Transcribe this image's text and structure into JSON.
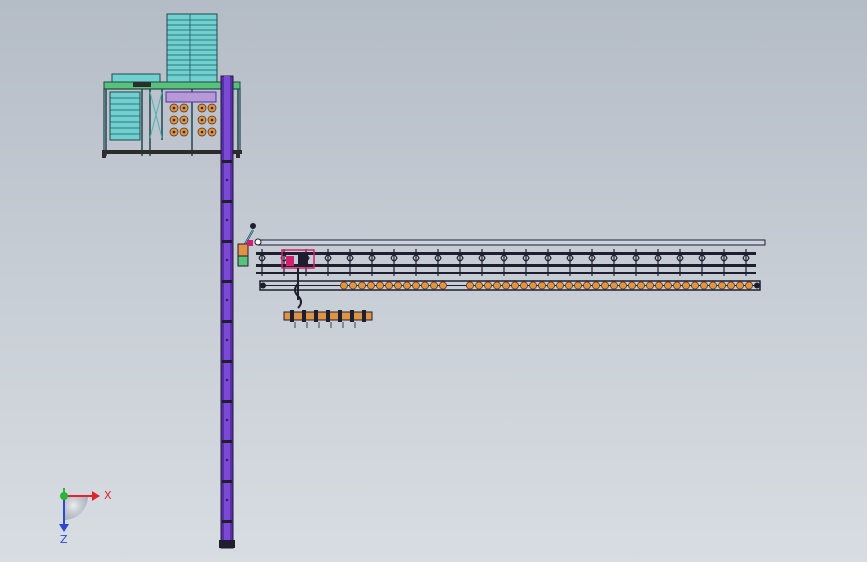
{
  "viewport": {
    "background_top": "#b4bcc6",
    "background_bottom": "#d8dde2"
  },
  "colors": {
    "frame_cyan": "#45b6b6",
    "frame_dark": "#20474d",
    "column_purple": "#5b2bb0",
    "roller_orange": "#e09443",
    "line_dark": "#1e1e2e",
    "accent_magenta": "#d1206f",
    "rail_light": "#c9d4e0",
    "axis_x": "#e0262b",
    "axis_y": "#2bb33a",
    "axis_z": "#2d49d6"
  },
  "triad": {
    "x_label": "X",
    "z_label": "Z",
    "x_icon": "x-axis-arrow-icon",
    "y_icon": "y-axis-dot-icon",
    "z_icon": "z-axis-arrow-icon"
  }
}
